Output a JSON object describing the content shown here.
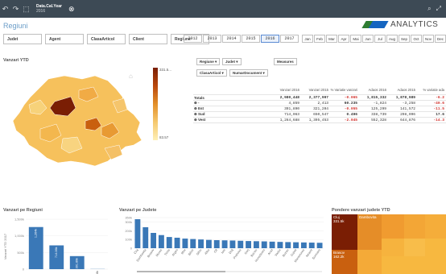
{
  "topbar": {
    "field": "Data.Cal.Year",
    "value": "2016"
  },
  "page": {
    "title": "Regiuni"
  },
  "brand": {
    "name": "ANALYTICS"
  },
  "filters": [
    "Judet",
    "Agent",
    "ClasaArticol",
    "Client",
    "Regiune"
  ],
  "years": [
    "2012",
    "2013",
    "2014",
    "2015",
    "2016",
    "2017"
  ],
  "selected_year": "2016",
  "months": [
    "Jan",
    "Feb",
    "Mar",
    "Apr",
    "Mai",
    "Jun",
    "Jul",
    "Aug",
    "Sep",
    "Oct",
    "Nov",
    "Dec"
  ],
  "map": {
    "title": "Vanzari YTD",
    "legend_max": "331.5...",
    "legend_min": "83.57"
  },
  "pivot": {
    "dims": [
      "Regiune",
      "Judet",
      "ClasaArticol",
      "NumarDocument"
    ],
    "measures_label": "Measures",
    "columns": [
      "Vanzari 2016",
      "Vanzari 2015",
      "% Variatie vanzari",
      "Adaos 2016",
      "Adaos 2015",
      "% variatie ada"
    ],
    "rows": [
      {
        "label": "Totals",
        "vals": [
          "2,980,448",
          "2,377,997",
          "-0.065",
          "1,815,332",
          "1,878,989",
          "-6.2"
        ]
      },
      {
        "label": "⊕ -",
        "vals": [
          "4,859",
          "2,413",
          "60.235",
          "-1,824",
          "-3,258",
          "-40.6"
        ]
      },
      {
        "label": "⊕ Est",
        "vals": [
          "391,890",
          "321,204",
          "-0.055",
          "125,299",
          "141,572",
          "-11.5"
        ]
      },
      {
        "label": "⊕ Sud",
        "vals": [
          "714,063",
          "650,547",
          "0.496",
          "338,739",
          "298,096",
          "17.6"
        ]
      },
      {
        "label": "⊕ Vest",
        "vals": [
          "1,264,688",
          "1,395,453",
          "-2.045",
          "552,328",
          "644,876",
          "-14.3"
        ]
      }
    ]
  },
  "regions": {
    "title": "Vanzari pe Regiuni"
  },
  "judete": {
    "title": "Vanzari pe Judete"
  },
  "treemap": {
    "title": "Pondere vanzari judete YTD",
    "top_label": "Cluj",
    "top_value": "331.5k",
    "second_label": "Dambovita",
    "third_label": "Brasov",
    "third_value": "162.2k"
  },
  "chart_data": [
    {
      "type": "bar",
      "title": "Vanzari pe Regiuni",
      "ylabel": "Vanzari YTD 2017",
      "ylim": [
        0,
        1500000
      ],
      "categories": [
        "Vest",
        "Sud",
        "Est",
        "-"
      ],
      "values": [
        1264688,
        714063,
        391890,
        4859
      ],
      "data_labels": [
        "1,264k",
        "714.06k",
        "391.89k",
        "4.86k"
      ],
      "yticks": [
        "0",
        "500k",
        "1,000k",
        "1,500k"
      ]
    },
    {
      "type": "bar",
      "title": "Vanzari pe Judete",
      "ylim": [
        0,
        350000
      ],
      "yticks": [
        "0",
        "100k",
        "200k",
        "300k",
        "350k"
      ],
      "categories": [
        "Cluj",
        "Dambovita",
        "Brasov",
        "Mures",
        "Timis",
        "Arges",
        "Ilfov",
        "Bihor",
        "Sibiu",
        "Alba",
        "Olt",
        "Iasi",
        "Dolj",
        "Prahova",
        "Gorj",
        "Bacau",
        "Hunedoara",
        "Arad",
        "Vaslui",
        "Buzau",
        "Galati",
        "Maramures",
        "Neamt",
        "Suceava"
      ],
      "values": [
        331500,
        240000,
        175000,
        150000,
        128000,
        120000,
        110000,
        105000,
        100000,
        95000,
        92000,
        90000,
        88000,
        85000,
        82000,
        80000,
        78000,
        75000,
        72000,
        70000,
        68000,
        66000,
        64000,
        62000
      ]
    }
  ]
}
